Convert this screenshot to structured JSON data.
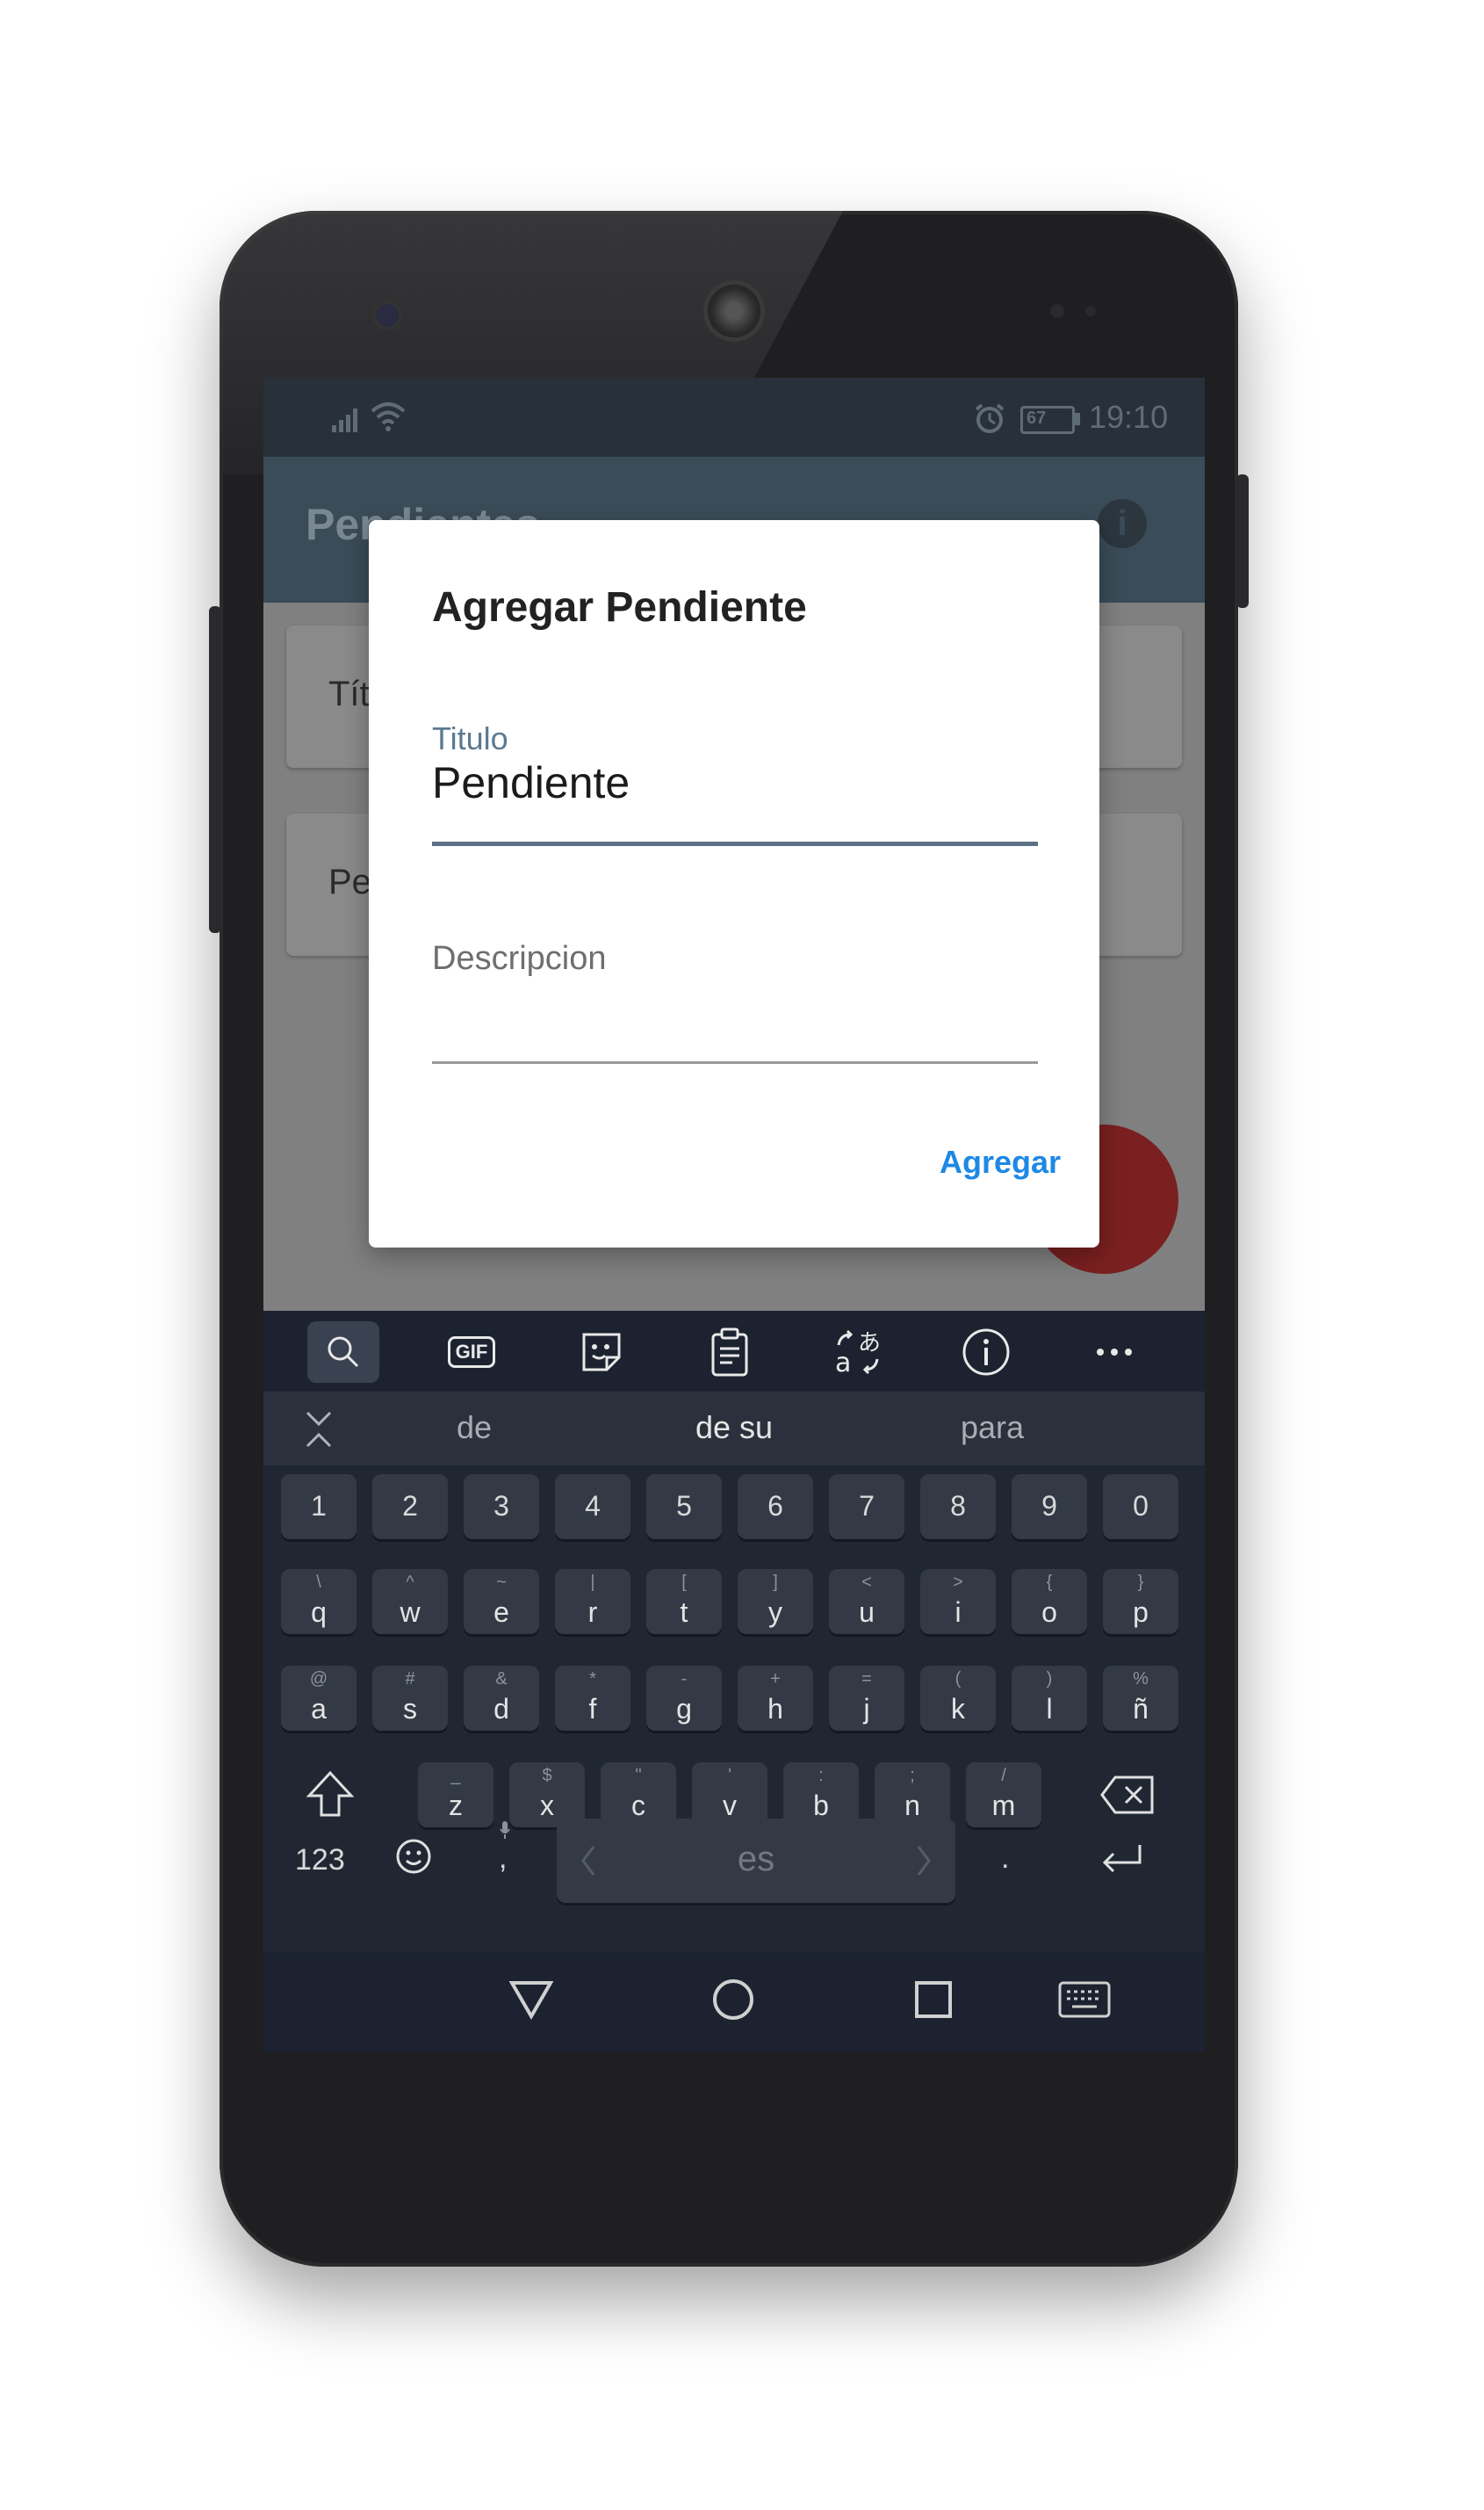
{
  "status_bar": {
    "time": "19:10",
    "battery": "67"
  },
  "app_bar": {
    "title": "Pendientes"
  },
  "cards": [
    {
      "label": "Títu"
    },
    {
      "label": "Pe"
    }
  ],
  "dialog": {
    "title": "Agregar Pendiente",
    "titulo_label": "Titulo",
    "titulo_value": "Pendiente",
    "descripcion_placeholder": "Descripcion",
    "agregar_label": "Agregar"
  },
  "keyboard": {
    "toolbar_icons": [
      "search-icon",
      "gif-icon",
      "sticker-icon",
      "clipboard-icon",
      "translate-icon",
      "info-icon",
      "more-icon"
    ],
    "gif_label": "GIF",
    "suggestions": [
      "de",
      "de su",
      "para"
    ],
    "number_row": [
      "1",
      "2",
      "3",
      "4",
      "5",
      "6",
      "7",
      "8",
      "9",
      "0"
    ],
    "row1": [
      {
        "main": "q",
        "alt": "\\"
      },
      {
        "main": "w",
        "alt": "^"
      },
      {
        "main": "e",
        "alt": "~"
      },
      {
        "main": "r",
        "alt": "|"
      },
      {
        "main": "t",
        "alt": "["
      },
      {
        "main": "y",
        "alt": "]"
      },
      {
        "main": "u",
        "alt": "<"
      },
      {
        "main": "i",
        "alt": ">"
      },
      {
        "main": "o",
        "alt": "{"
      },
      {
        "main": "p",
        "alt": "}"
      }
    ],
    "row2": [
      {
        "main": "a",
        "alt": "@"
      },
      {
        "main": "s",
        "alt": "#"
      },
      {
        "main": "d",
        "alt": "&"
      },
      {
        "main": "f",
        "alt": "*"
      },
      {
        "main": "g",
        "alt": "-"
      },
      {
        "main": "h",
        "alt": "+"
      },
      {
        "main": "j",
        "alt": "="
      },
      {
        "main": "k",
        "alt": "("
      },
      {
        "main": "l",
        "alt": ")"
      },
      {
        "main": "ñ",
        "alt": "%"
      }
    ],
    "row3": [
      {
        "main": "z",
        "alt": "_"
      },
      {
        "main": "x",
        "alt": "$"
      },
      {
        "main": "c",
        "alt": "\""
      },
      {
        "main": "v",
        "alt": "'"
      },
      {
        "main": "b",
        "alt": ":"
      },
      {
        "main": "n",
        "alt": ";"
      },
      {
        "main": "m",
        "alt": "/"
      }
    ],
    "symbols_label": "123",
    "comma_label": ",",
    "space_label": "es",
    "period_label": "."
  },
  "colors": {
    "accent": "#1e88e5",
    "app_bar": "#3a4c58",
    "keyboard_bg": "#202733",
    "key_bg": "#333a46"
  }
}
